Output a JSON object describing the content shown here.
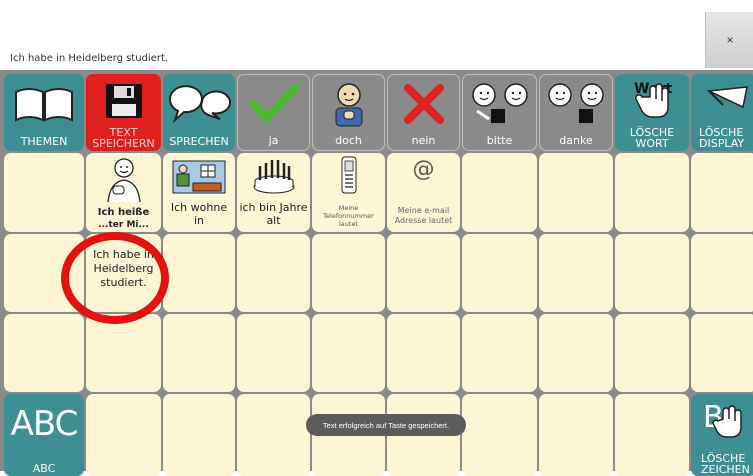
{
  "message_bar": {
    "text": "Ich habe in Heidelberg studiert.",
    "close_glyph": "×"
  },
  "toolbar": {
    "themen": "THEMEN",
    "text_speichern": "TEXT\nSPEICHERN",
    "sprechen": "SPRECHEN",
    "ja": "ja",
    "doch": "doch",
    "nein": "nein",
    "bitte": "bitte",
    "danke": "danke",
    "loesche_wort": "LÖSCHE\nWORT",
    "loesche_display": "LÖSCHE\nDISPLAY",
    "wort_icon_text": "Wort"
  },
  "phrases": {
    "ich_heisse": "Ich heiße",
    "ich_heisse_cut": "...ter Mi...",
    "ich_wohne_in": "Ich wohne in",
    "ich_bin_jahre_alt": "ich bin Jahre alt",
    "telefonnummer": "Meine Telefonnummer lautet",
    "email_symbol": "@",
    "email": "Meine e-mail Adresse lautet",
    "heidelberg": "Ich habe in Heidelberg studiert."
  },
  "bottom": {
    "abc_big": "ABC",
    "abc_label": "ABC",
    "loesche_zeichen": "LÖSCHE\nZEICHEN",
    "b_icon_text": "B"
  },
  "toast": "Text erfolgreich auf Taste gespeichert.",
  "colors": {
    "teal": "#3e8f93",
    "cream": "#fcf6d4",
    "red": "#e01f1f",
    "gray": "#8a8a8a",
    "annotation": "#e4120f"
  }
}
